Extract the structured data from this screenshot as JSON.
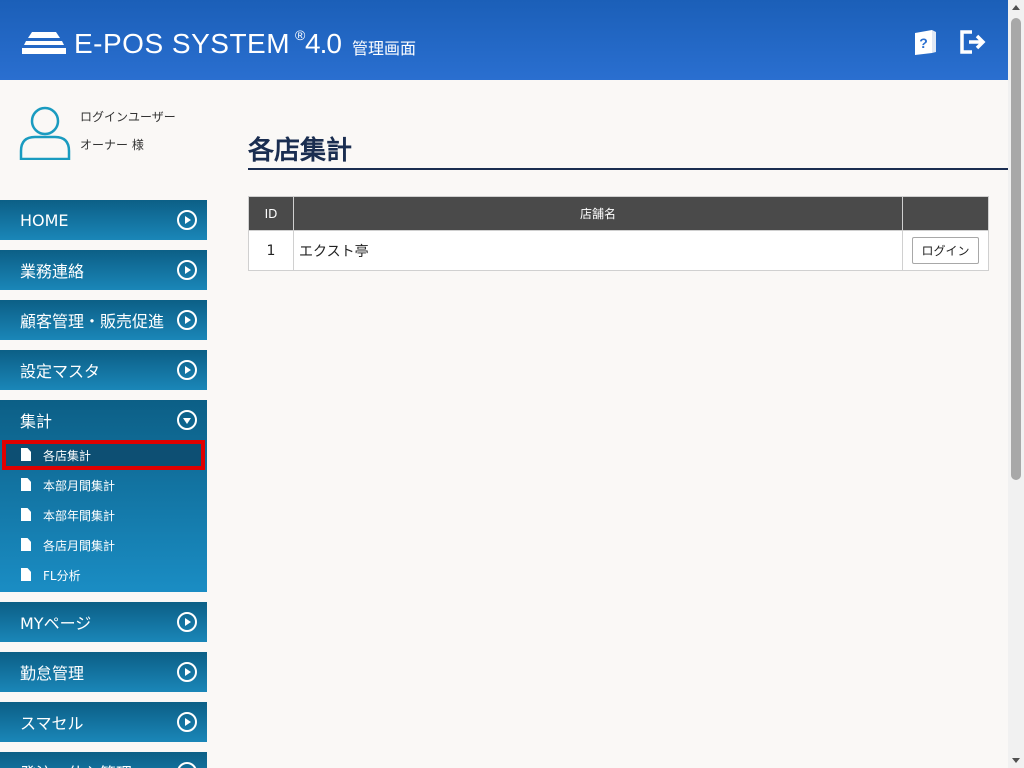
{
  "header": {
    "logo_text": "E-POS SYSTEM",
    "logo_reg": "®",
    "logo_version": "4.0",
    "logo_sub": "管理画面",
    "help_icon": "help-book-icon",
    "logout_icon": "logout-icon",
    "colors": {
      "header_bg": "#2a6fd0",
      "nav_bg": "#1a86b8",
      "active_outline": "#e00000"
    }
  },
  "user": {
    "label": "ログインユーザー",
    "name": "オーナー 様"
  },
  "sidebar": {
    "items": [
      {
        "label": "HOME"
      },
      {
        "label": "業務連絡"
      },
      {
        "label": "顧客管理・販売促進"
      },
      {
        "label": "設定マスタ"
      }
    ],
    "expanded": {
      "label": "集計",
      "subitems": [
        {
          "label": "各店集計"
        },
        {
          "label": "本部月間集計"
        },
        {
          "label": "本部年間集計"
        },
        {
          "label": "各店月間集計"
        },
        {
          "label": "FL分析"
        }
      ]
    },
    "items_after": [
      {
        "label": "MYページ"
      },
      {
        "label": "勤怠管理"
      },
      {
        "label": "スマセル"
      },
      {
        "label": "発注・仕入管理"
      }
    ]
  },
  "main": {
    "title": "各店集計",
    "table": {
      "headers": [
        "ID",
        "店舗名",
        ""
      ],
      "rows": [
        {
          "id": "1",
          "name": "エクスト亭",
          "action": "ログイン"
        }
      ]
    }
  }
}
